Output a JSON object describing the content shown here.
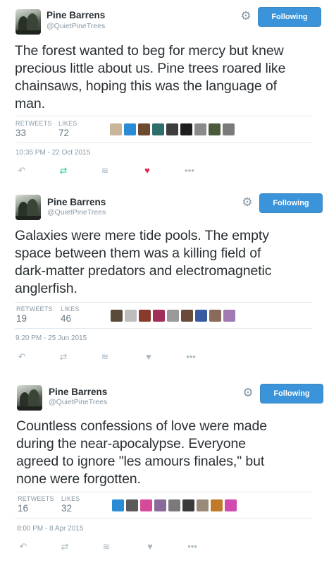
{
  "user": {
    "name": "Pine Barrens",
    "handle": "@QuietPineTrees",
    "follow_label": "Following"
  },
  "stat_labels": {
    "retweets": "RETWEETS",
    "likes": "LIKES"
  },
  "icons": {
    "gear": "gear-icon",
    "reply": "reply-icon",
    "retweet": "retweet-icon",
    "stack": "stack-icon",
    "heart": "heart-icon",
    "more": "more-icon"
  },
  "colors": {
    "follow_button": "#3b94d9",
    "retweet_active": "#19cf86",
    "like_active": "#e81c4f",
    "muted": "#8899a6"
  },
  "tweets": [
    {
      "text_lines": [
        "The forest wanted to beg for mercy but knew",
        "precious little about us. Pine trees roared like",
        "chainsaws, hoping this was the language of",
        "man."
      ],
      "retweets": "33",
      "likes": "72",
      "timestamp": "10:35 PM - 22 Oct 2015",
      "retweeted": true,
      "liked": true,
      "liker_colors": [
        "#c9b59a",
        "#2b8cd6",
        "#6b4a2f",
        "#2f6f6a",
        "#3d3d3d",
        "#1e1e1e",
        "#8a8a8a",
        "#4a5a3c",
        "#7a7a7a"
      ]
    },
    {
      "text_lines": [
        "Galaxies were mere tide pools. The empty",
        "space between them was a killing field of",
        "dark-matter predators and electromagnetic",
        "anglerfish."
      ],
      "retweets": "19",
      "likes": "46",
      "timestamp": "9:20 PM - 25 Jun 2015",
      "retweeted": false,
      "liked": false,
      "liker_colors": [
        "#5a4a3a",
        "#bdbdbd",
        "#8a3a2a",
        "#a0305a",
        "#9a9a9a",
        "#6a4a3a",
        "#3a5aa0",
        "#8a6a5a",
        "#a07ab0"
      ]
    },
    {
      "text_lines": [
        "Countless confessions of love were made",
        "during the near-apocalypse. Everyone",
        "agreed to ignore \"les amours finales,\" but",
        "none were forgotten."
      ],
      "retweets": "16",
      "likes": "32",
      "timestamp": "8:00 PM - 8 Apr 2015",
      "retweeted": false,
      "liked": false,
      "liker_colors": [
        "#2b8cd6",
        "#5a5a5a",
        "#d64a9a",
        "#8a6a9a",
        "#7a7a7a",
        "#3a3a3a",
        "#9a8a7a",
        "#c07a2a",
        "#d04ab0"
      ]
    }
  ]
}
